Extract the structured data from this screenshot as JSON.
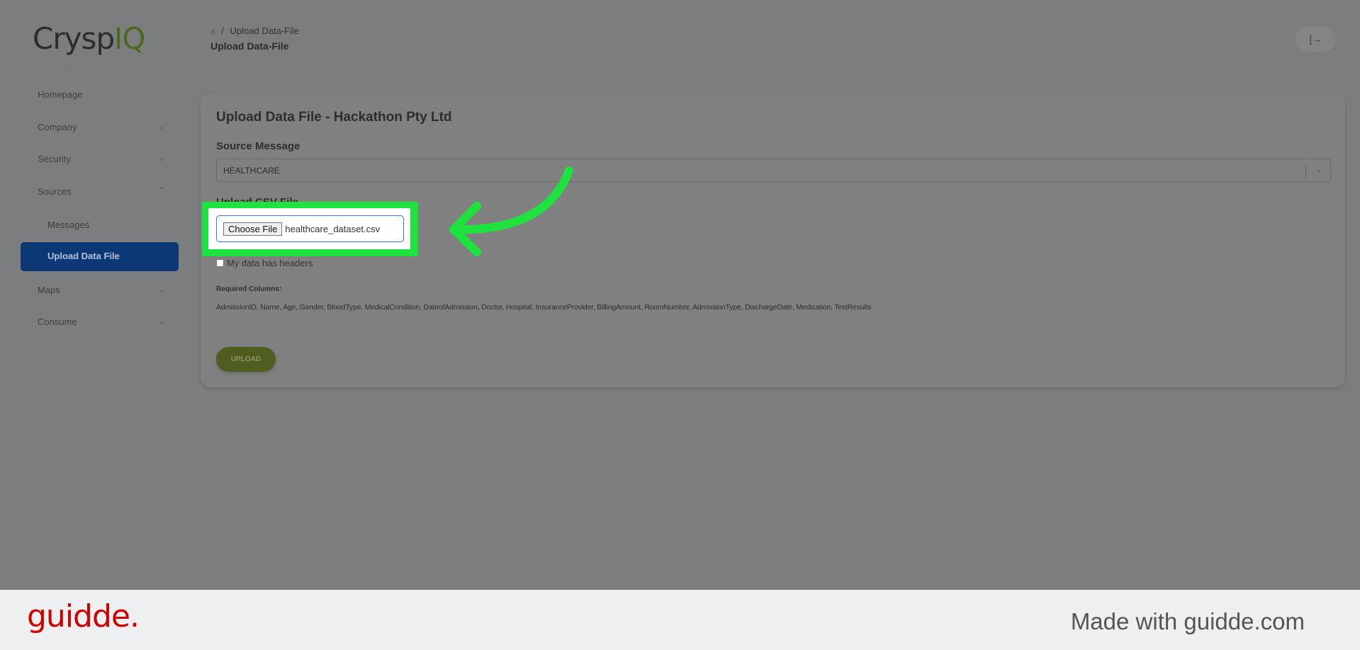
{
  "logo": {
    "text_main": "Crysp",
    "text_accent": "IQ"
  },
  "sidebar": {
    "items": [
      {
        "label": "Homepage"
      },
      {
        "label": "Company",
        "chevron": "chevron-down"
      },
      {
        "label": "Security",
        "chevron": "chevron-down"
      },
      {
        "label": "Sources",
        "chevron": "chevron-up"
      },
      {
        "label": "Messages"
      },
      {
        "label": "Upload Data File",
        "active": true
      },
      {
        "label": "Maps",
        "chevron": "chevron-down"
      },
      {
        "label": "Consume",
        "chevron": "chevron-down"
      }
    ]
  },
  "header": {
    "breadcrumb": "Upload Data-File",
    "separator": "/",
    "title": "Upload Data-File",
    "home_icon": "home-icon",
    "logout_icon": "logout-icon"
  },
  "card": {
    "title": "Upload Data File - Hackathon Pty Ltd",
    "source_label": "Source Message",
    "source_value": "HEALTHCARE",
    "csv_label": "Upload CSV File",
    "choose_file": "Choose File",
    "file_name": "healthcare_dataset.csv",
    "headers_checkbox": "My data has headers",
    "required_label": "Required Columns:",
    "required_columns": "AdmissionID, Name, Age, Gender, BloodType, MedicalCondition, DateofAdmission, Doctor, Hospital, InsuranceProvider, BillingAmount, RoomNumber, AdmissionType, DischargeDate, Medication, TestResults",
    "upload_button": "UPLOAD"
  },
  "colors": {
    "highlight": "#1ee33f",
    "active_nav": "#0c3876",
    "upload_button": "#4f5e1e",
    "guidde_brand": "#d00000"
  },
  "footer": {
    "brand": "guidde.",
    "made_with": "Made with guidde.com"
  }
}
